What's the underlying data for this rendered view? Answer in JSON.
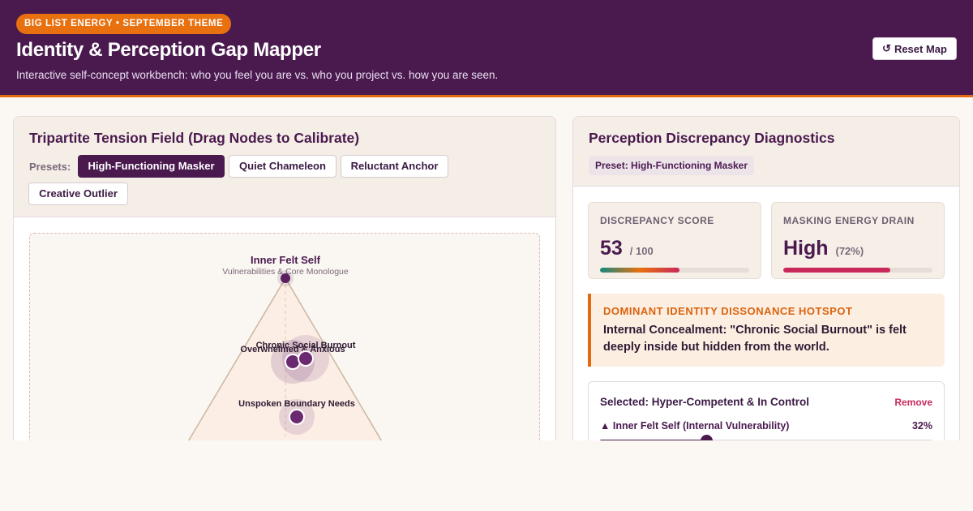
{
  "header": {
    "badge": "BIG LIST ENERGY • SEPTEMBER THEME",
    "title": "Identity & Perception Gap Mapper",
    "subtitle": "Interactive self-concept workbench: who you feel you are vs. who you project vs. how you are seen.",
    "reset_icon": "↺",
    "reset_label": "Reset Map"
  },
  "left_panel": {
    "title": "Tripartite Tension Field (Drag Nodes to Calibrate)",
    "presets_label": "Presets:",
    "presets": [
      {
        "label": "High-Functioning Masker",
        "active": true
      },
      {
        "label": "Quiet Chameleon",
        "active": false
      },
      {
        "label": "Reluctant Anchor",
        "active": false
      },
      {
        "label": "Creative Outlier",
        "active": false
      }
    ],
    "field": {
      "vertex_top_title": "Inner Felt Self",
      "vertex_top_sub": "Vulnerabilities & Core Monologue",
      "nodes": [
        {
          "label": "Overwhelmed & Anxious"
        },
        {
          "label": "Chronic Social Burnout"
        },
        {
          "label": "Unspoken Boundary Needs"
        }
      ]
    }
  },
  "right_panel": {
    "title": "Perception Discrepancy Diagnostics",
    "preset_chip": "Preset: High-Functioning Masker",
    "discrepancy": {
      "label": "DISCREPANCY SCORE",
      "value": "53",
      "unit": "/ 100",
      "fraction": 0.53
    },
    "masking": {
      "label": "MASKING ENERGY DRAIN",
      "value": "High",
      "unit": "(72%)",
      "fraction": 0.72
    },
    "hotspot": {
      "label": "DOMINANT IDENTITY DISSONANCE HOTSPOT",
      "text": "Internal Concealment: \"Chronic Social Burnout\" is felt deeply inside but hidden from the world."
    },
    "selected": {
      "title": "Selected: Hyper-Competent & In Control",
      "remove_label": "Remove",
      "slider_label": "▲ Inner Felt Self (Internal Vulnerability)",
      "slider_value": "32%",
      "slider_fraction": 0.32
    }
  },
  "colors": {
    "brand": "#4a1a4f",
    "accent": "#e46a12",
    "danger": "#c9285b"
  }
}
